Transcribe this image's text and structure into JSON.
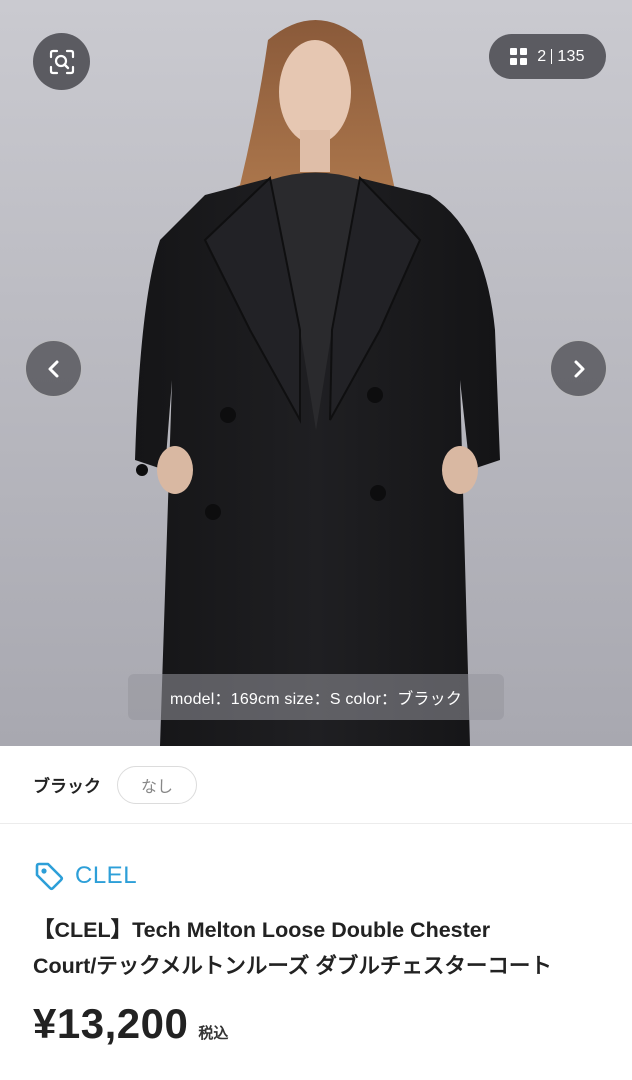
{
  "gallery": {
    "current": "2",
    "total": "135",
    "caption": "model：169cm size：S color：ブラック"
  },
  "variant": {
    "color_label": "ブラック",
    "size_option": "なし"
  },
  "product": {
    "brand": "CLEL",
    "title_line1": "【CLEL】Tech Melton Loose Double Chester",
    "title_line2": "Court/テックメルトンルーズ ダブルチェスターコート",
    "price": "¥13,200",
    "tax_note": "税込"
  },
  "colors": {
    "brand_accent": "#2d9fd8",
    "overlay_button": "#3c3c42"
  },
  "icons": {
    "search": "image-search-icon",
    "grid": "grid-icon",
    "prev": "chevron-left-icon",
    "next": "chevron-right-icon",
    "tag": "tag-icon"
  }
}
